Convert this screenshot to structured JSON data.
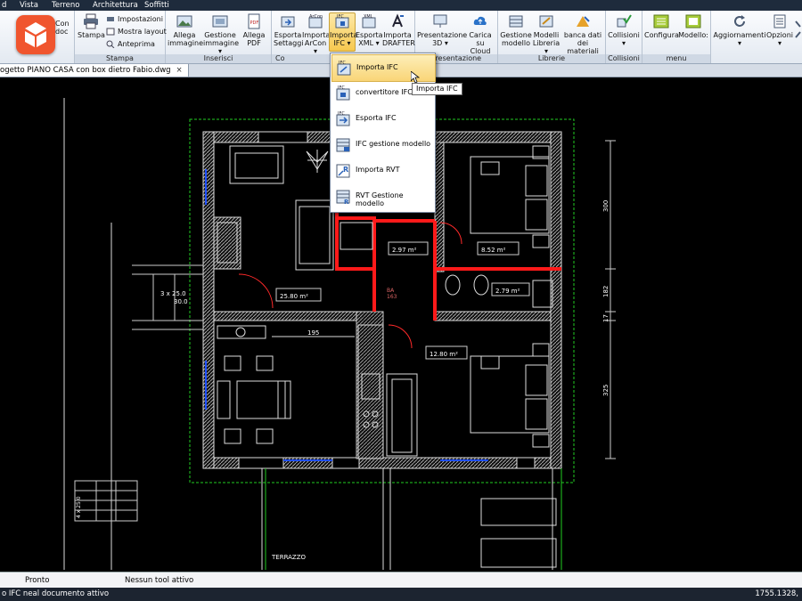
{
  "menubar": {
    "items": [
      "d",
      "Vista",
      "Terreno",
      "Architettura",
      "Soffitti"
    ]
  },
  "ribbon": {
    "groups": [
      {
        "label": "Stampa"
      },
      {
        "label": "Inserisci"
      },
      {
        "label": "Co"
      },
      {
        "label": "Presentazione"
      },
      {
        "label": "Librerie"
      },
      {
        "label": "Collisioni"
      },
      {
        "label": "menu"
      }
    ],
    "left_partial": {
      "line1": "Con",
      "line2": "doc"
    },
    "stampa": {
      "big": "Stampa",
      "impostazioni": "Impostazioni",
      "mostra_layout": "Mostra layout",
      "anteprima": "Anteprima"
    },
    "inserisci": {
      "allega_immagine": [
        "Allega",
        "immagine"
      ],
      "gestione_immagine": [
        "Gestione",
        "immagine ▾"
      ],
      "allega_pdf": [
        "Allega",
        "PDF"
      ],
      "pdf_badge": "PDF"
    },
    "co": {
      "esporta_settaggi": [
        "Esporta",
        "Settaggi"
      ],
      "importa_arcon": [
        "Importa",
        "ArCon ▾"
      ],
      "importa_ifc": [
        "Importa",
        "IFC ▾"
      ],
      "esporta_xml": [
        "Esporta",
        "XML ▾"
      ],
      "importa_drafter": [
        "Importa",
        "DRAFTER"
      ],
      "arcon_badge": "ArCon",
      "ifc_badge": "IFC",
      "xml_badge": "XML"
    },
    "presentazione": {
      "presentazione_3d": [
        "Presentazione",
        "3D ▾"
      ],
      "carica_cloud": [
        "Carica",
        "su Cloud"
      ]
    },
    "librerie": {
      "gestione_modello": [
        "Gestione",
        "modello"
      ],
      "modelli_libreria": [
        "Modelli",
        "Libreria ▾"
      ],
      "banca_dati": [
        "banca dati",
        "dei materiali"
      ]
    },
    "collisioni": {
      "collisioni": [
        "Collisioni",
        "▾"
      ]
    },
    "menu": {
      "configura": "Configura",
      "modello": "Modello:"
    },
    "right": {
      "aggiornamenti": [
        "Aggiornamenti",
        "▾"
      ],
      "opzioni": [
        "Opzioni",
        "▾"
      ]
    }
  },
  "document_tab": {
    "title": "ogetto PIANO CASA  con box dietro Fabio.dwg",
    "close": "×"
  },
  "dropdown": {
    "items": [
      {
        "label": "Importa IFC",
        "icon": "ifc-import-icon",
        "badge": "IFC"
      },
      {
        "label": "convertitore IFC",
        "icon": "ifc-converter-icon",
        "badge": "IFC"
      },
      {
        "label": "Esporta IFC",
        "icon": "ifc-export-icon",
        "badge": "IFC"
      },
      {
        "label": "IFC gestione modello",
        "icon": "ifc-model-icon",
        "badge": ""
      },
      {
        "label": "Importa RVT",
        "icon": "rvt-import-icon",
        "badge": "R"
      },
      {
        "label": "RVT Gestione modello",
        "icon": "rvt-model-icon",
        "badge": "R"
      }
    ]
  },
  "tooltip": "Importa IFC",
  "drawing": {
    "areas": [
      "25.80 m²",
      "2.97 m²",
      "8.52 m²",
      "2.79 m²",
      "12.80 m²"
    ],
    "dims": [
      "300",
      "182",
      "17",
      "325",
      "195",
      "3 x 25.0",
      "30.0",
      "4 x 25.0"
    ],
    "terrace": "TERRAZZO",
    "small_text": [
      "BA",
      "163"
    ]
  },
  "statusbar": {
    "left": "Pronto",
    "middle": "Nessun tool attivo"
  },
  "cmdbar": {
    "left": "o IFC neal documento attivo",
    "right": "1755.1328,"
  },
  "colors": {
    "wall_hatch": "#bfbfbf",
    "red_walls": "#ff1a1a",
    "green_boundary": "#22cc22",
    "blue": "#2050ff",
    "accent_logo": "#f0552e"
  }
}
